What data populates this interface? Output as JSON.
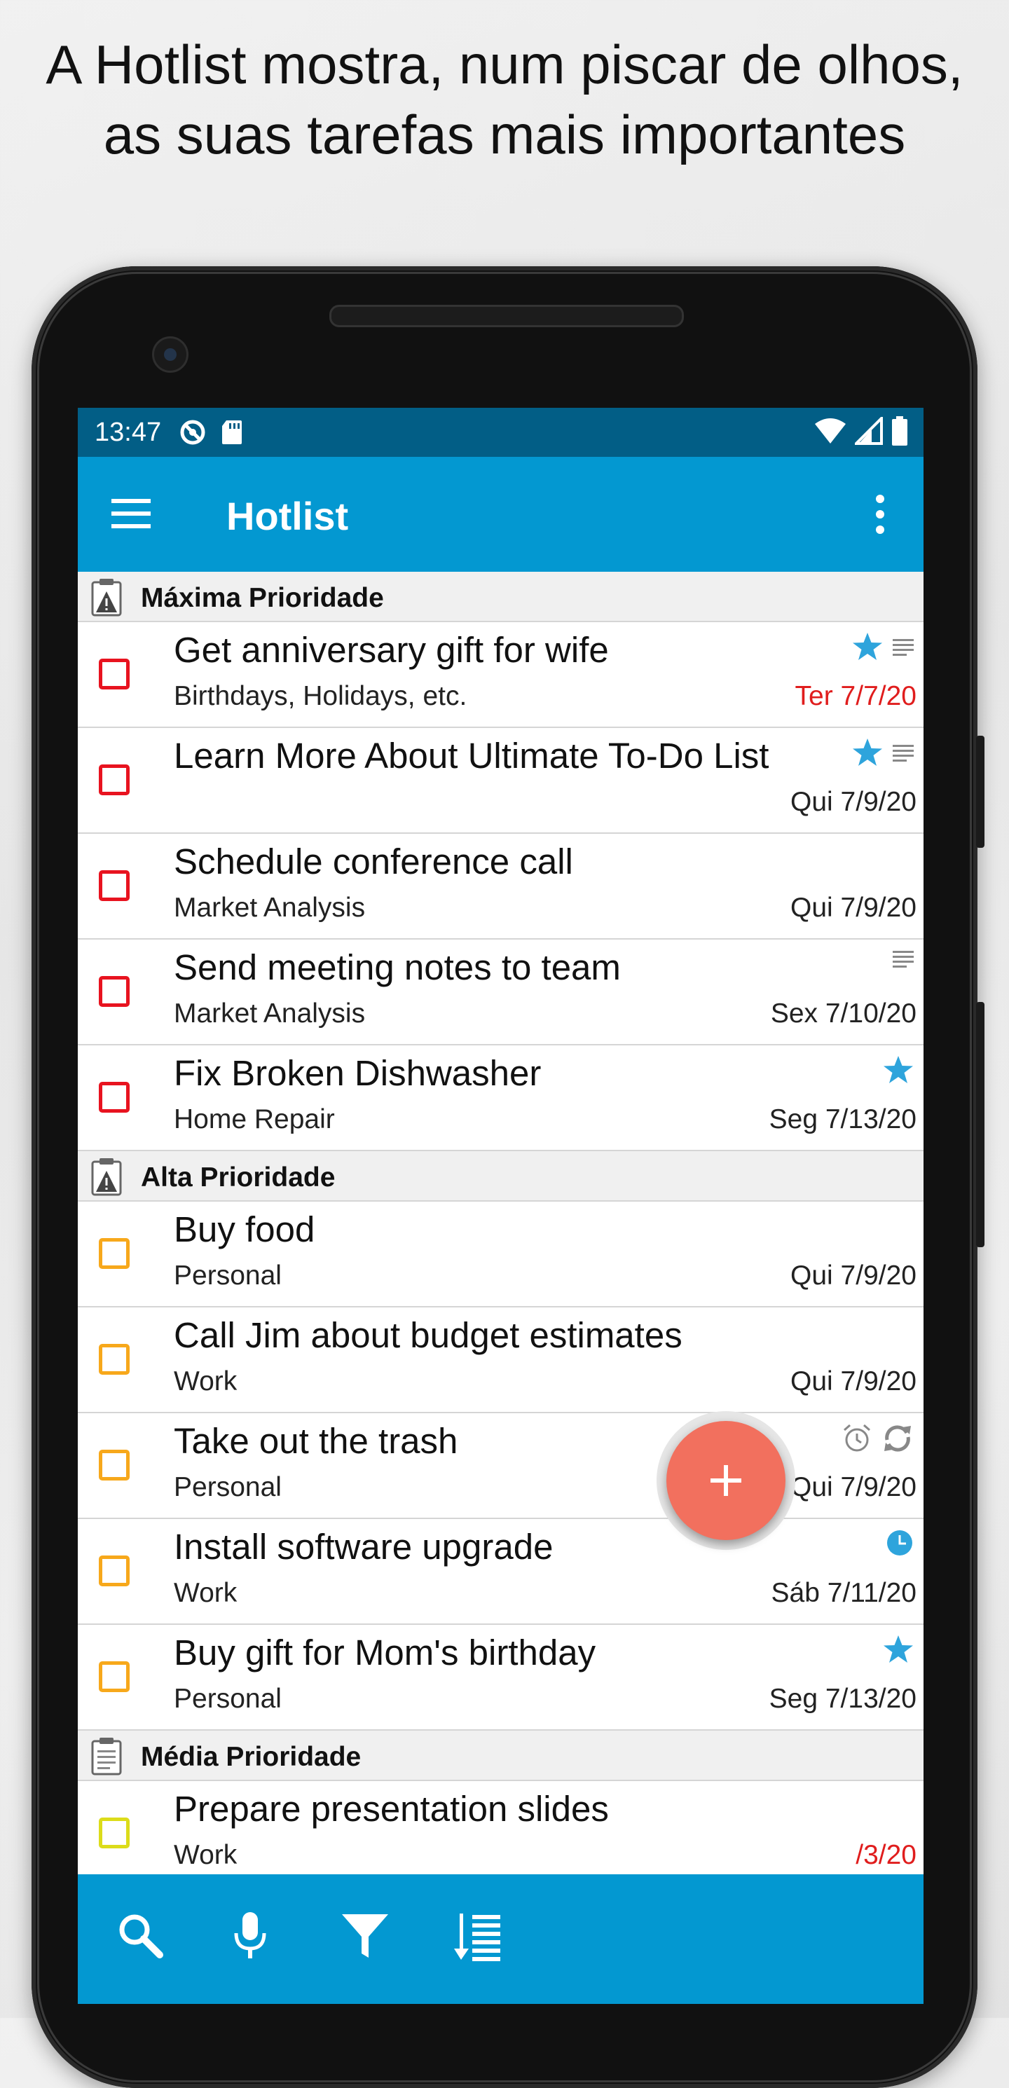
{
  "headline": "A Hotlist mostra, num piscar de olhos, as suas tarefas mais importantes",
  "status_bar": {
    "time": "13:47"
  },
  "app_bar": {
    "title": "Hotlist"
  },
  "colors": {
    "status_bar": "#025e86",
    "app_bar": "#0398d1",
    "fab": "#f2705e",
    "priority_max": "#e8131f",
    "priority_high": "#f7a81b",
    "priority_medium": "#dcdc1a",
    "overdue_date": "#e01d1d",
    "star": "#2ea4dc"
  },
  "sections": [
    {
      "label": "Máxima Prioridade",
      "tasks": [
        {
          "name": "Get anniversary gift for wife",
          "category": "Birthdays, Holidays, etc.",
          "date": "Ter 7/7/20",
          "overdue": true,
          "icons": [
            "star-icon",
            "note-icon"
          ]
        },
        {
          "name": "Learn More About Ultimate To-Do List",
          "category": "",
          "date": "Qui 7/9/20",
          "overdue": false,
          "icons": [
            "star-icon",
            "note-icon"
          ]
        },
        {
          "name": "Schedule conference call",
          "category": "Market Analysis",
          "date": "Qui 7/9/20",
          "overdue": false,
          "icons": []
        },
        {
          "name": "Send meeting notes to team",
          "category": "Market Analysis",
          "date": "Sex 7/10/20",
          "overdue": false,
          "icons": [
            "note-icon"
          ]
        },
        {
          "name": "Fix Broken Dishwasher",
          "category": "Home Repair",
          "date": "Seg 7/13/20",
          "overdue": false,
          "icons": [
            "star-icon"
          ]
        }
      ]
    },
    {
      "label": "Alta Prioridade",
      "tasks": [
        {
          "name": "Buy food",
          "category": "Personal",
          "date": "Qui 7/9/20",
          "overdue": false,
          "icons": []
        },
        {
          "name": "Call Jim about budget estimates",
          "category": "Work",
          "date": "Qui 7/9/20",
          "overdue": false,
          "icons": []
        },
        {
          "name": "Take out the trash",
          "category": "Personal",
          "date": "Qui 7/9/20",
          "overdue": false,
          "icons": [
            "alarm-icon",
            "repeat-icon"
          ]
        },
        {
          "name": "Install software upgrade",
          "category": "Work",
          "date": "Sáb 7/11/20",
          "overdue": false,
          "icons": [
            "clock-icon"
          ]
        },
        {
          "name": "Buy gift for Mom's birthday",
          "category": "Personal",
          "date": "Seg 7/13/20",
          "overdue": false,
          "icons": [
            "star-icon"
          ]
        }
      ]
    },
    {
      "label": "Média Prioridade",
      "tasks": [
        {
          "name": "Prepare presentation slides",
          "category": "Work",
          "date": "/3/20",
          "overdue": true,
          "icons": []
        }
      ]
    }
  ],
  "bottom_bar": {
    "icons": [
      "search-icon",
      "microphone-icon",
      "filter-icon",
      "sort-icon"
    ]
  },
  "fab": {
    "icon": "plus-icon",
    "label": "+"
  }
}
